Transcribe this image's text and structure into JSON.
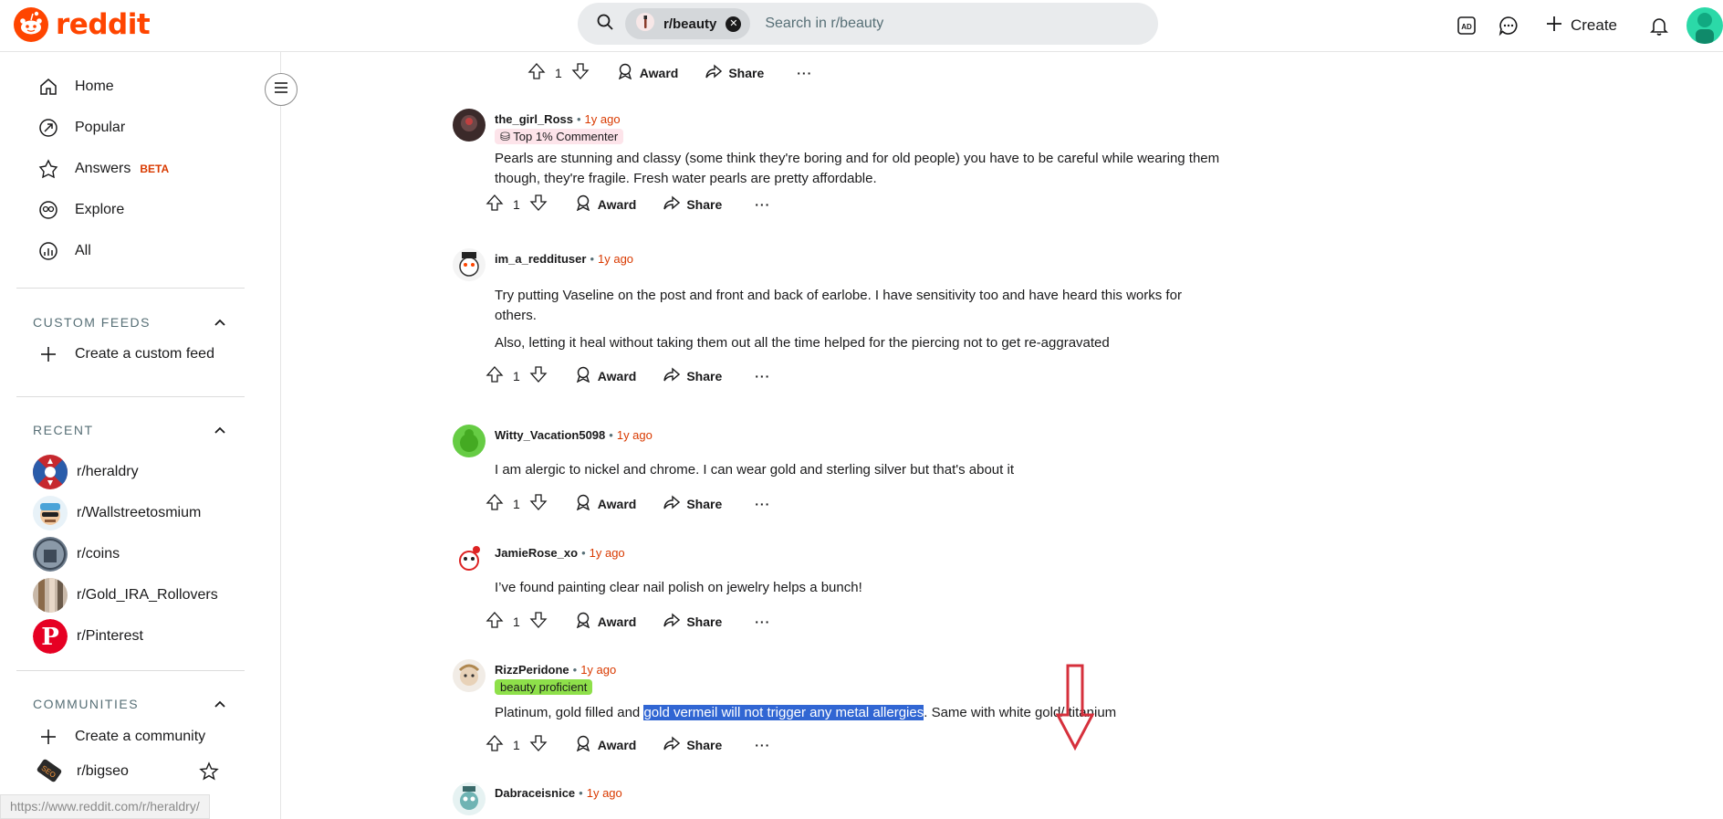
{
  "header": {
    "logo_text": "reddit",
    "search_chip": "r/beauty",
    "search_placeholder": "Search in r/beauty",
    "create_label": "Create"
  },
  "sidebar": {
    "nav": [
      {
        "label": "Home"
      },
      {
        "label": "Popular"
      },
      {
        "label": "Answers",
        "badge": "BETA"
      },
      {
        "label": "Explore"
      },
      {
        "label": "All"
      }
    ],
    "custom_feeds": {
      "heading": "CUSTOM FEEDS",
      "create_label": "Create a custom feed"
    },
    "recent": {
      "heading": "RECENT",
      "items": [
        "r/heraldry",
        "r/Wallstreetosmium",
        "r/coins",
        "r/Gold_IRA_Rollovers",
        "r/Pinterest"
      ]
    },
    "communities": {
      "heading": "COMMUNITIES",
      "create_label": "Create a community",
      "items": [
        "r/bigseo"
      ]
    },
    "status_url": "https://www.reddit.com/r/heraldry/"
  },
  "actions": {
    "award_label": "Award",
    "share_label": "Share",
    "more_label": "···"
  },
  "top_action_count": "1",
  "comments": [
    {
      "user": "the_girl_Ross",
      "time": "1y ago",
      "flair": "Top 1% Commenter",
      "body": [
        "Pearls are stunning and classy (some think they're boring and for old people) you have to be careful while wearing them though, they're fragile. Fresh water pearls are pretty affordable."
      ],
      "votes": "1"
    },
    {
      "user": "im_a_reddituser",
      "time": "1y ago",
      "body": [
        "Try putting Vaseline on the post and front and back of earlobe. I have sensitivity too and have heard this works for others.",
        "Also, letting it heal without taking them out all the time helped for the piercing not to get re-aggravated"
      ],
      "votes": "1"
    },
    {
      "user": "Witty_Vacation5098",
      "time": "1y ago",
      "body": [
        "I am alergic to nickel and chrome. I can wear gold and sterling silver but that's about it"
      ],
      "votes": "1"
    },
    {
      "user": "JamieRose_xo",
      "time": "1y ago",
      "body": [
        "I’ve found painting clear nail polish on jewelry helps a bunch!"
      ],
      "votes": "1"
    },
    {
      "user": "RizzPeridone",
      "time": "1y ago",
      "flair": "beauty proficient",
      "body_parts": {
        "before": "Platinum, gold filled and ",
        "highlight": "gold vermeil will not trigger any metal allergies",
        "after": ". Same with white gold/ titanium"
      },
      "votes": "1"
    },
    {
      "user": "Dabraceisnice",
      "time": "1y ago"
    }
  ],
  "colors": {
    "brand": "#ff4500",
    "time": "#d93a00",
    "highlight": "#3166d3",
    "annotation_arrow": "#d6303c"
  }
}
